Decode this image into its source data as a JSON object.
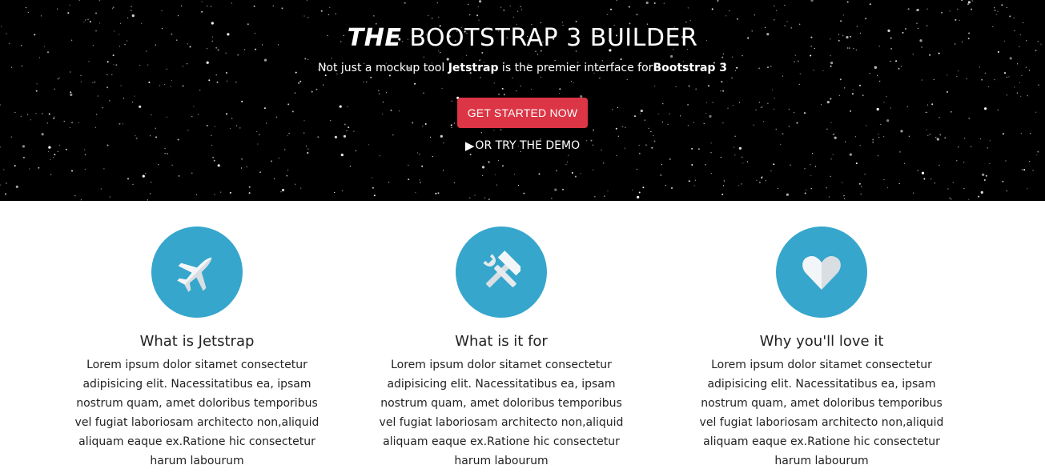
{
  "hero": {
    "title_italic": "THE",
    "title_rest": " BOOTSTRAP 3 BUILDER",
    "subtitle_pre": "Not just a mockup tool ",
    "subtitle_brand": "Jetstrap",
    "subtitle_mid": " is the premier interface for",
    "subtitle_bold": "Bootstrap 3",
    "cta_label": "GET STARTED NOW",
    "demo_icon": "play-icon",
    "demo_label": "OR TRY THE DEMO",
    "background_color": "#000000",
    "cta_color": "#dc3545"
  },
  "features": [
    {
      "icon": "jet-plane-icon",
      "title": "What is Jetstrap",
      "text": "Lorem ipsum dolor sitamet consectetur adipisicing elit. Nacessitatibus ea, ipsam nostrum quam, amet doloribus temporibus vel fugiat laboriosam architecto non,aliquid aliquam eaque ex.Ratione hic consectetur harum labourum"
    },
    {
      "icon": "hammer-wrench-icon",
      "title": "What is it for",
      "text": "Lorem ipsum dolor sitamet consectetur adipisicing elit. Nacessitatibus ea, ipsam nostrum quam, amet doloribus temporibus vel fugiat laboriosam architecto non,aliquid aliquam eaque ex.Ratione hic consectetur harum labourum"
    },
    {
      "icon": "heart-icon",
      "title": "Why you'll love it",
      "text": "Lorem ipsum dolor sitamet consectetur adipisicing elit. Nacessitatibus ea, ipsam nostrum quam, amet doloribus temporibus vel fugiat laboriosam architecto non,aliquid aliquam eaque ex.Ratione hic consectetur harum labourum"
    }
  ],
  "colors": {
    "icon_circle": "#36a6cc",
    "text": "#222222"
  }
}
